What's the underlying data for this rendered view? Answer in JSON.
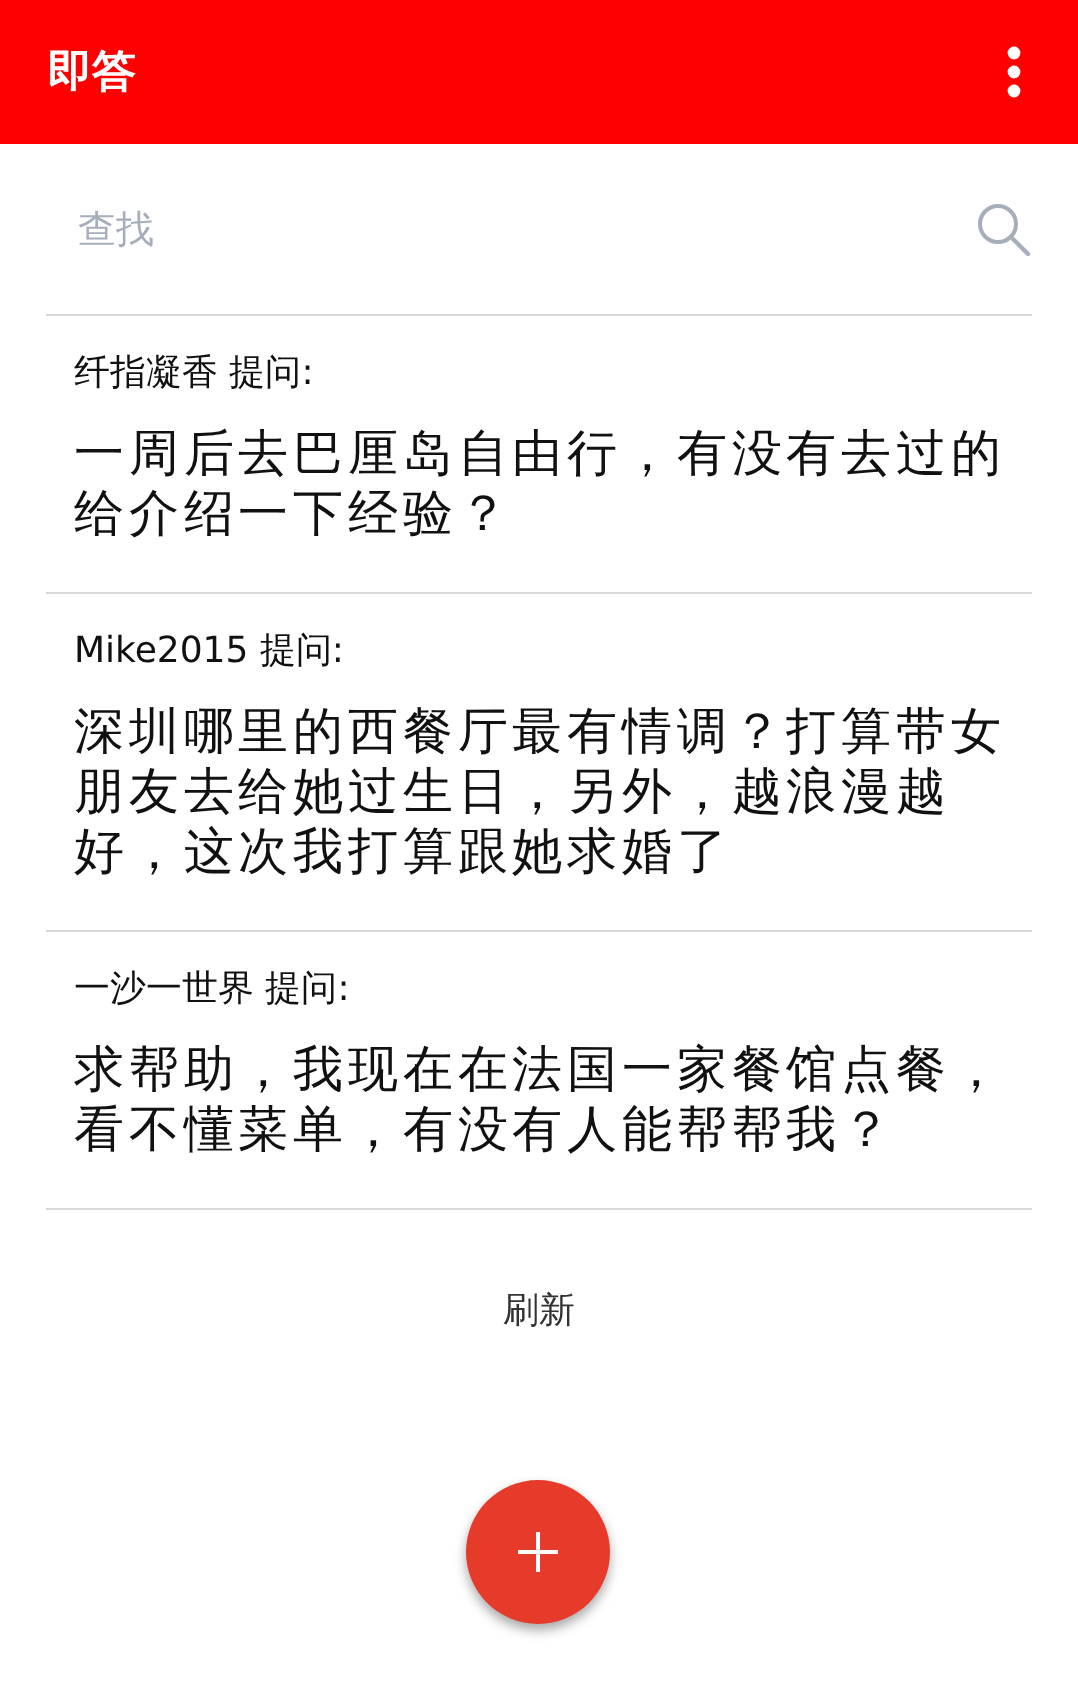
{
  "app_bar": {
    "title": "即答"
  },
  "search": {
    "placeholder": "查找"
  },
  "questions": [
    {
      "asker": "纤指凝香 提问:",
      "text": "一周后去巴厘岛自由行，有没有去过的给介绍一下经验？"
    },
    {
      "asker": "Mike2015 提问:",
      "text": "深圳哪里的西餐厅最有情调？打算带女朋友去给她过生日，另外，越浪漫越好，这次我打算跟她求婚了"
    },
    {
      "asker": "一沙一世界 提问:",
      "text": "求帮助，我现在在法国一家餐馆点餐，看不懂菜单，有没有人能帮帮我？"
    }
  ],
  "refresh": "刷新"
}
